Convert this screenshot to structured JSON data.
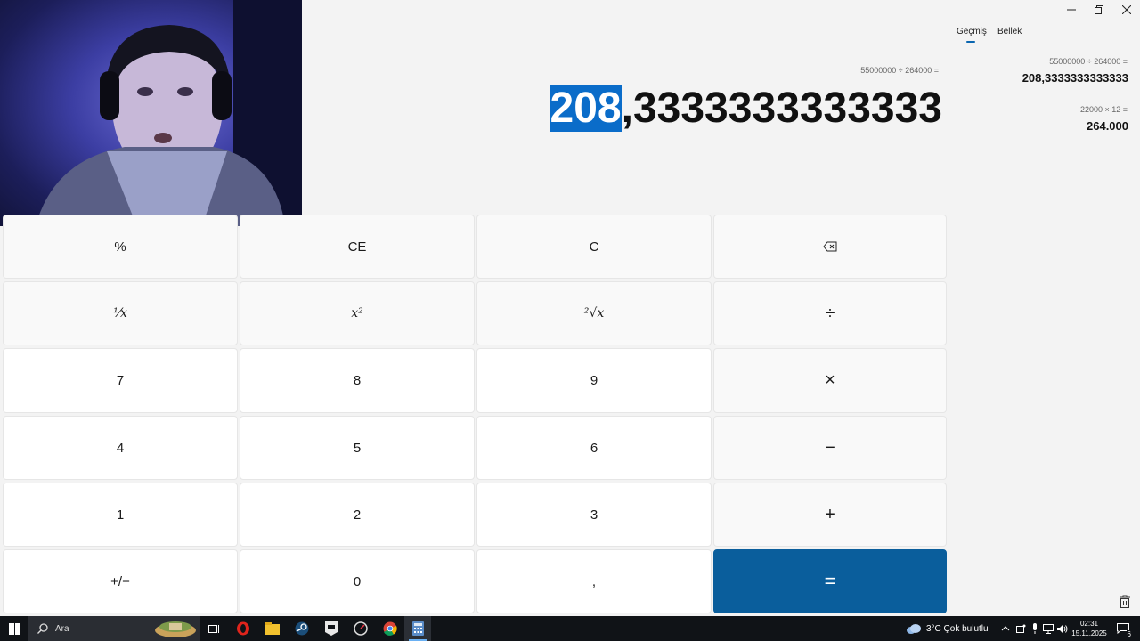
{
  "history_tabs": {
    "history": "Geçmiş",
    "memory": "Bellek"
  },
  "display": {
    "expression": "55000000 ÷ 264000 =",
    "result_selected": "208",
    "result_rest": ",3333333333333"
  },
  "history": [
    {
      "expression": "55000000   ÷   264000 =",
      "result": "208,3333333333333"
    },
    {
      "expression": "22000   ×   12 =",
      "result": "264.000"
    }
  ],
  "keys": {
    "percent": "%",
    "clear_entry": "CE",
    "clear": "C",
    "backspace": "⌫",
    "reciprocal": "⅟x",
    "square": "x²",
    "sqrt": "²√x",
    "divide": "÷",
    "seven": "7",
    "eight": "8",
    "nine": "9",
    "multiply": "×",
    "four": "4",
    "five": "5",
    "six": "6",
    "minus": "−",
    "one": "1",
    "two": "2",
    "three": "3",
    "plus": "+",
    "negate": "+/−",
    "zero": "0",
    "decimal": ",",
    "equals": "="
  },
  "taskbar": {
    "search_placeholder": "Ara",
    "weather": "3°C  Çok bulutlu",
    "time": "02:31",
    "date": "15.11.2025",
    "notifications": "6"
  },
  "colors": {
    "accent": "#0a5e9c",
    "selection": "#0a6cc9",
    "taskbar": "#101317"
  }
}
